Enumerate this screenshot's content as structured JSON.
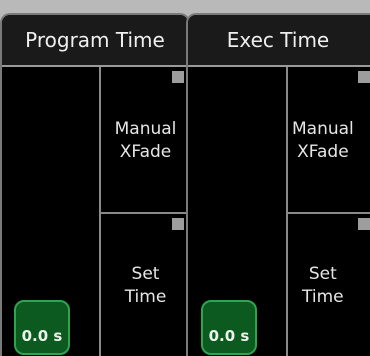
{
  "panels": [
    {
      "title": "Program Time",
      "cells": [
        {
          "label_line1": "Manual",
          "label_line2": "XFade"
        },
        {
          "label_line1": "Set",
          "label_line2": "Time"
        }
      ],
      "time_value": "0.0 s"
    },
    {
      "title": "Exec Time",
      "cells": [
        {
          "label_line1": "Manual",
          "label_line2": "XFade"
        },
        {
          "label_line1": "Set",
          "label_line2": "Time"
        }
      ],
      "time_value": "0.0 s"
    }
  ],
  "colors": {
    "time_button_bg": "#0c5a1f",
    "time_button_border": "#2fa44f",
    "indicator": "#9d9d9d"
  }
}
